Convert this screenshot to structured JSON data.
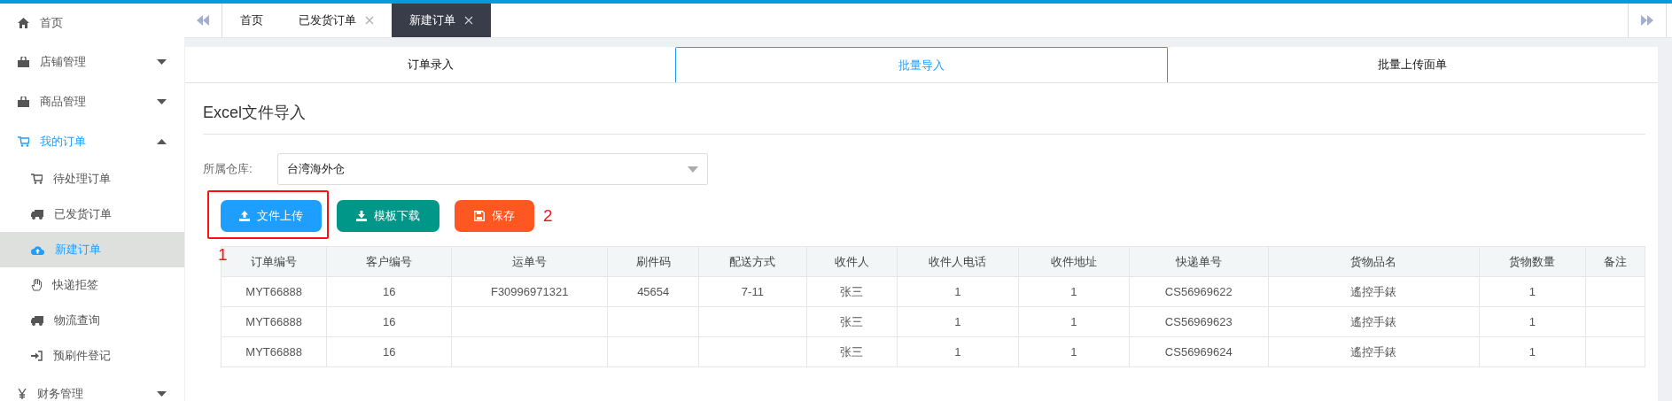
{
  "sidebar": {
    "items": [
      {
        "label": "首页",
        "kind": "home",
        "selected": false
      },
      {
        "label": "店铺管理",
        "kind": "bag",
        "selected": false,
        "expanded": false
      },
      {
        "label": "商品管理",
        "kind": "bag",
        "selected": false,
        "expanded": false
      },
      {
        "label": "我的订单",
        "kind": "cart",
        "selected": true,
        "expanded": true,
        "children": [
          {
            "label": "待处理订单",
            "kind": "cart",
            "selected": false
          },
          {
            "label": "已发货订单",
            "kind": "truck",
            "selected": false
          },
          {
            "label": "新建订单",
            "kind": "cloud",
            "selected": true
          },
          {
            "label": "快递拒签",
            "kind": "hand",
            "selected": false
          },
          {
            "label": "物流查询",
            "kind": "truck",
            "selected": false
          },
          {
            "label": "预刷件登记",
            "kind": "signin",
            "selected": false
          }
        ]
      },
      {
        "label": "财务管理",
        "kind": "yen",
        "selected": false,
        "expanded": false
      }
    ]
  },
  "page_tabs": [
    {
      "label": "首页",
      "selected": false,
      "closable": false
    },
    {
      "label": "已发货订单",
      "selected": false,
      "closable": true
    },
    {
      "label": "新建订单",
      "selected": true,
      "closable": true
    }
  ],
  "content_tabs": [
    {
      "label": "订单录入",
      "selected": false
    },
    {
      "label": "批量导入",
      "selected": true
    },
    {
      "label": "批量上传面单",
      "selected": false
    }
  ],
  "section_title": "Excel文件导入",
  "warehouse": {
    "label": "所属仓库:",
    "value": "台湾海外仓"
  },
  "buttons": [
    {
      "label": "文件上传",
      "kind": "upload",
      "highlighted": true
    },
    {
      "label": "模板下载",
      "kind": "download",
      "highlighted": false
    },
    {
      "label": "保存",
      "kind": "save",
      "highlighted": false
    }
  ],
  "annotations": [
    "1",
    "2"
  ],
  "table": {
    "columns": [
      "订单编号",
      "客户编号",
      "运单号",
      "刷件码",
      "配送方式",
      "收件人",
      "收件人电话",
      "收件地址",
      "快递单号",
      "货物品名",
      "货物数量",
      "备注"
    ],
    "rows": [
      [
        "MYT66888",
        "16",
        "F30996971321",
        "45654",
        "7-11",
        "张三",
        "1",
        "1",
        "CS56969622",
        "遙控手錶",
        "1",
        ""
      ],
      [
        "MYT66888",
        "16",
        "",
        "",
        "",
        "张三",
        "1",
        "1",
        "CS56969623",
        "遙控手錶",
        "1",
        ""
      ],
      [
        "MYT66888",
        "16",
        "",
        "",
        "",
        "张三",
        "1",
        "1",
        "CS56969624",
        "遙控手錶",
        "1",
        ""
      ]
    ]
  }
}
